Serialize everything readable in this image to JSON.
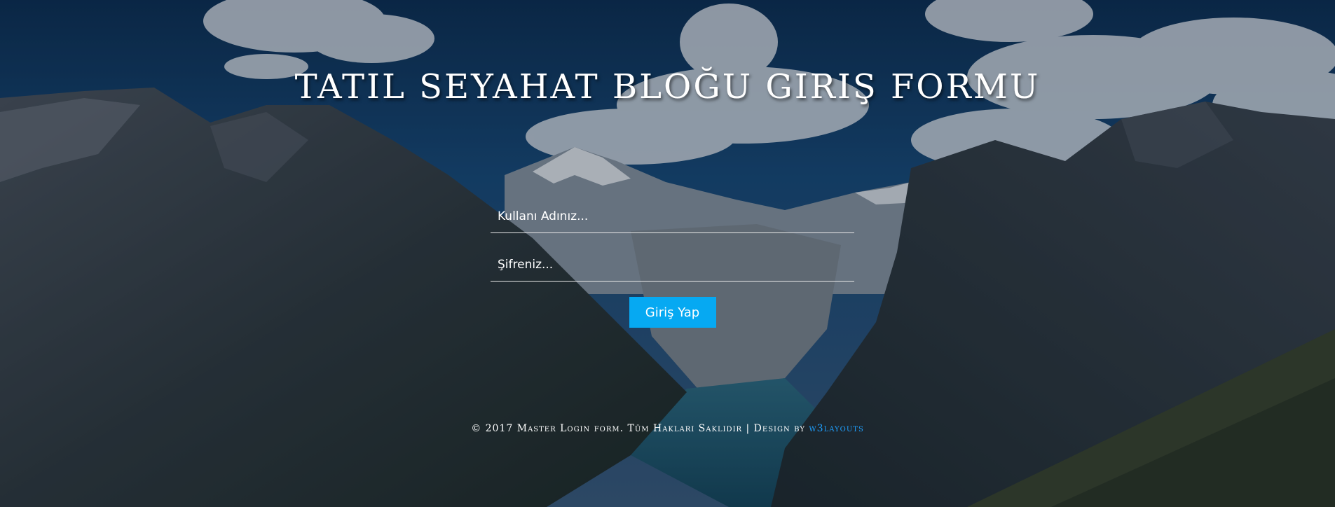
{
  "page": {
    "title": "TATIL SEYAHAT BLOĞU GIRIŞ FORMU"
  },
  "login_form": {
    "username_placeholder": "Kullanı Adınız...",
    "username_value": "",
    "password_placeholder": "Şifreniz...",
    "password_value": "",
    "submit_label": "Giriş Yap"
  },
  "footer": {
    "text": "© 2017 Master Login form. Tüm Hakları Saklıdır | Design by ",
    "link_text": "w3layouts"
  },
  "colors": {
    "button_bg": "#06a9f2",
    "link": "#1fa0ff",
    "sky": "#0d3a66"
  },
  "icons": {
    "background": "mountain-lake-photo"
  }
}
